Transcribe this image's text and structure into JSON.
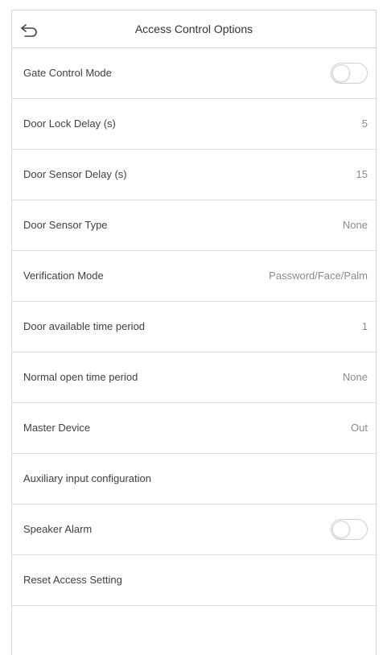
{
  "header": {
    "title": "Access Control Options",
    "back_icon": "back-arrow-icon"
  },
  "settings": [
    {
      "label": "Gate Control Mode",
      "type": "toggle",
      "checked": false
    },
    {
      "label": "Door Lock Delay (s)",
      "type": "value",
      "value": "5"
    },
    {
      "label": "Door Sensor Delay (s)",
      "type": "value",
      "value": "15"
    },
    {
      "label": "Door Sensor Type",
      "type": "value",
      "value": "None"
    },
    {
      "label": "Verification Mode",
      "type": "value",
      "value": "Password/Face/Palm"
    },
    {
      "label": "Door available time period",
      "type": "value",
      "value": "1"
    },
    {
      "label": "Normal open time period",
      "type": "value",
      "value": "None"
    },
    {
      "label": "Master Device",
      "type": "value",
      "value": "Out"
    },
    {
      "label": "Auxiliary input configuration",
      "type": "none"
    },
    {
      "label": "Speaker Alarm",
      "type": "toggle",
      "checked": false
    },
    {
      "label": "Reset Access Setting",
      "type": "none"
    }
  ],
  "colors": {
    "border": "#d4d4d4",
    "text": "#404040",
    "value_text": "#8a8a8a"
  }
}
